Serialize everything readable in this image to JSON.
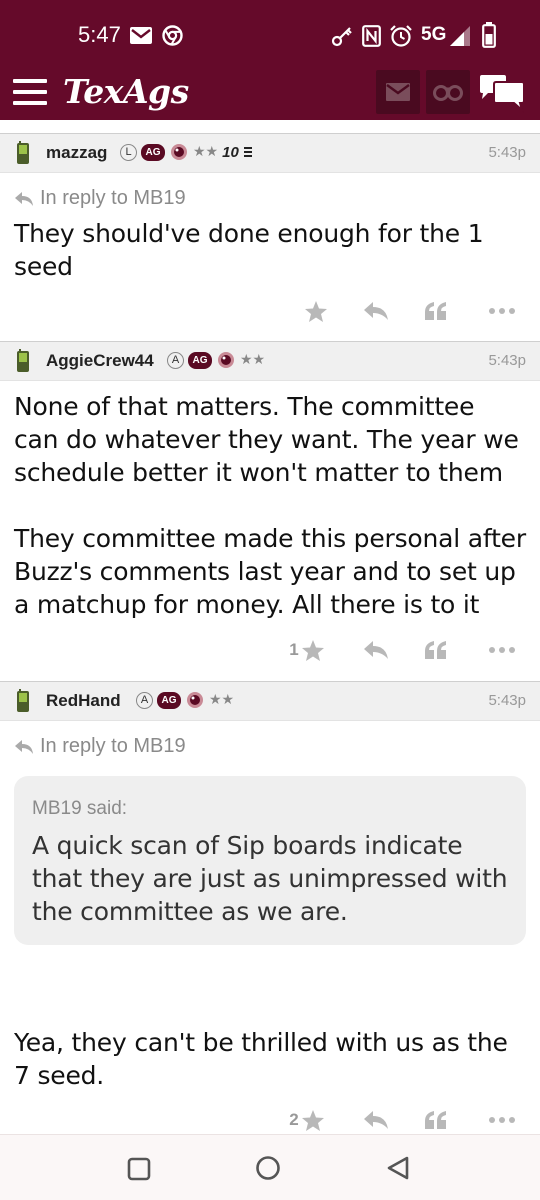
{
  "status_bar": {
    "time": "5:47",
    "network": "5G",
    "icons": [
      "mail-icon",
      "chrome-icon",
      "key-icon",
      "nfc-icon",
      "alarm-icon",
      "signal-icon",
      "battery-icon"
    ]
  },
  "app_header": {
    "logo": "TexAgs",
    "icons": [
      "menu-icon",
      "mail-icon",
      "binoculars-icon",
      "chat-icon"
    ],
    "colors": {
      "brand": "#650a2a",
      "brand_dark": "#4a0a20"
    }
  },
  "posts": [
    {
      "username": "mazzag",
      "badges": [
        "L",
        "AG",
        "★★",
        "10"
      ],
      "time": "5:43p",
      "reply_to": "In reply to MB19",
      "body": "They should've done enough for the 1 seed",
      "star_count": ""
    },
    {
      "username": "AggieCrew44",
      "badges": [
        "A",
        "AG",
        "★★"
      ],
      "time": "5:43p",
      "body_p1": "None of that matters. The committee can do whatever they want. The year we schedule better it won't matter to them",
      "body_p2": "They committee made this personal after Buzz's comments last year and to set up a matchup for money. All there is to it",
      "star_count": "1"
    },
    {
      "username": "RedHand",
      "badges": [
        "A",
        "AG",
        "★★"
      ],
      "time": "5:43p",
      "reply_to": "In reply to MB19",
      "quote": {
        "label": "MB19 said:",
        "text": "A quick scan of Sip boards indicate that they are just as unimpressed with the committee as we are."
      },
      "body": "Yea, they can't be thrilled with us as the 7 seed.",
      "star_count": "2"
    }
  ],
  "nav_bar": {
    "icons": [
      "recents-icon",
      "home-icon",
      "back-icon"
    ]
  }
}
